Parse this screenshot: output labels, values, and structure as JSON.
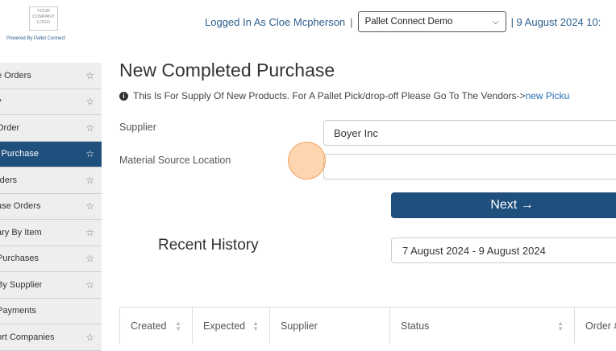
{
  "header": {
    "logo_text": "YOUR COMPANY LOGO",
    "powered_by": "Powered By Pallet Connect",
    "logged_in": "Logged In As Cloe Mcpherson",
    "separator": "|",
    "demo_select_value": "Pallet Connect Demo",
    "datetime": "| 9 August 2024 10:"
  },
  "sidebar": {
    "items": [
      {
        "label": "e Orders",
        "starred": false
      },
      {
        "label": "y",
        "starred": false
      },
      {
        "label": "Order",
        "starred": false
      },
      {
        "label": "l Purchase",
        "starred": false,
        "active": true
      },
      {
        "label": "rders",
        "starred": false
      },
      {
        "label": "ase Orders",
        "starred": false
      },
      {
        "label": "ary By Item",
        "starred": false
      },
      {
        "label": "Purchases",
        "starred": false
      },
      {
        "label": "By Supplier",
        "starred": false
      },
      {
        "label": "Payments",
        "starred": false
      },
      {
        "label": "ort Companies",
        "starred": false
      }
    ]
  },
  "main": {
    "title": "New Completed Purchase",
    "info_text": "This Is For Supply Of New Products. For A Pallet Pick/drop-off Please Go To The Vendors->",
    "info_link": "new Picku",
    "supplier_label": "Supplier",
    "supplier_value": "Boyer Inc",
    "material_label": "Material Source Location",
    "material_value": "",
    "next_button": "Next →",
    "recent_history": "Recent History",
    "date_range": "7 August 2024 - 9 August 2024"
  },
  "table": {
    "columns": [
      "Created",
      "Expected",
      "Supplier",
      "Status",
      "Order #"
    ]
  },
  "icons": {
    "star": "star-outline-icon",
    "info": "info-circle-icon",
    "chevron": "chevron-down-icon"
  }
}
